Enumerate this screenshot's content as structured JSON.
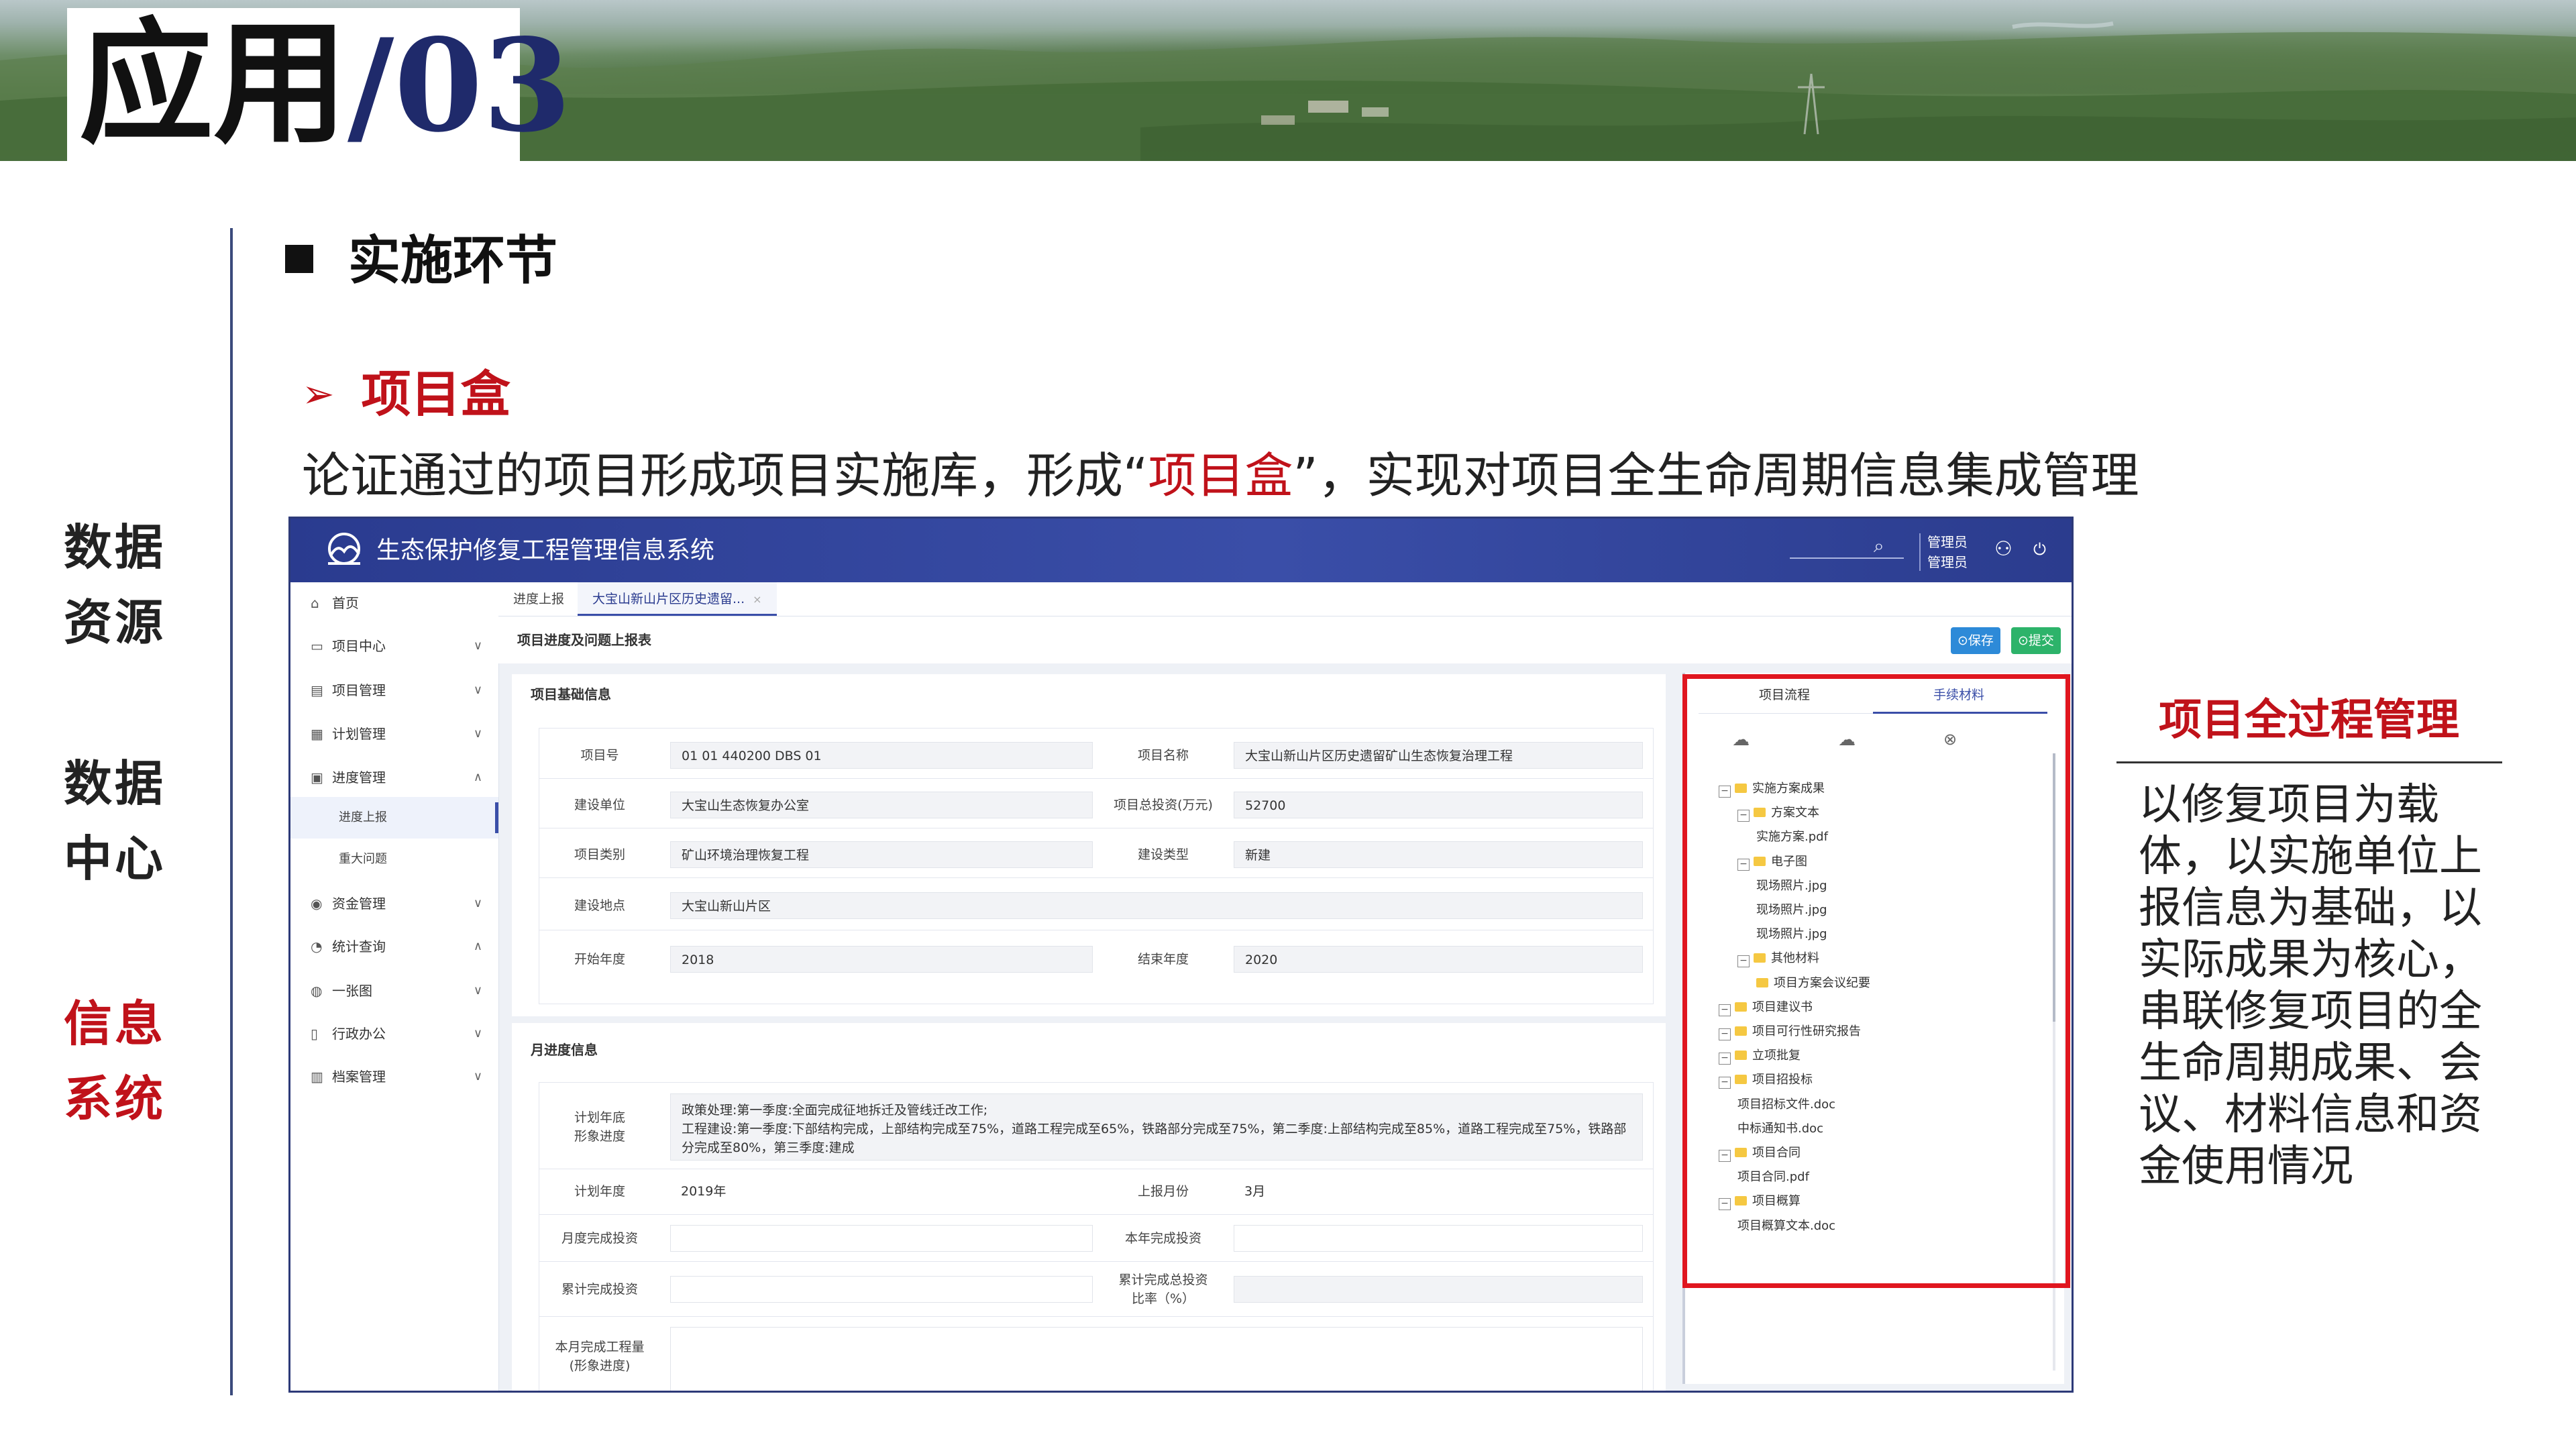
{
  "banner": {
    "title_cn": "应用",
    "title_num": "/03"
  },
  "side_labels": [
    {
      "line1": "数据",
      "line2": "资源"
    },
    {
      "line1": "数据",
      "line2": "中心"
    },
    {
      "line1": "信息",
      "line2": "系统"
    }
  ],
  "section": {
    "title": "实施环节"
  },
  "subsection": {
    "title": "项目盒"
  },
  "description": {
    "before": "论证通过的项目形成项目实施库，形成“",
    "highlight": "项目盒",
    "after": "”，实现对项目全生命周期信息集成管理"
  },
  "app": {
    "title": "生态保护修复工程管理信息系统",
    "user_line1": "管理员",
    "user_line2": "管理员",
    "sidebar": [
      {
        "icon": "home-icon",
        "label": "首页",
        "chevron": ""
      },
      {
        "icon": "calendar-icon",
        "label": "项目中心",
        "chevron": "∨"
      },
      {
        "icon": "folder-icon",
        "label": "项目管理",
        "chevron": "∨"
      },
      {
        "icon": "plan-icon",
        "label": "计划管理",
        "chevron": "∨"
      },
      {
        "icon": "progress-icon",
        "label": "进度管理",
        "chevron": "∧"
      },
      {
        "icon": "",
        "label": "进度上报",
        "chevron": ""
      },
      {
        "icon": "",
        "label": "重大问题",
        "chevron": ""
      },
      {
        "icon": "coin-icon",
        "label": "资金管理",
        "chevron": "∨"
      },
      {
        "icon": "chart-icon",
        "label": "统计查询",
        "chevron": "∧"
      },
      {
        "icon": "map-icon",
        "label": "一张图",
        "chevron": "∨"
      },
      {
        "icon": "office-icon",
        "label": "行政办公",
        "chevron": "∨"
      },
      {
        "icon": "archive-icon",
        "label": "档案管理",
        "chevron": "∨"
      }
    ],
    "tabs": [
      {
        "label": "进度上报"
      },
      {
        "label": "大宝山新山片区历史遗留..."
      }
    ],
    "page_title": "项目进度及问题上报表",
    "buttons": {
      "save": "⊙保存",
      "submit": "⊙提交"
    },
    "basic_info": {
      "title": "项目基础信息",
      "rows": [
        {
          "l1": "项目号",
          "v1": "01 01 440200 DBS 01",
          "l2": "项目名称",
          "v2": "大宝山新山片区历史遗留矿山生态恢复治理工程"
        },
        {
          "l1": "建设单位",
          "v1": "大宝山生态恢复办公室",
          "l2": "项目总投资(万元)",
          "v2": "52700"
        },
        {
          "l1": "项目类别",
          "v1": "矿山环境治理恢复工程",
          "l2": "建设类型",
          "v2": "新建"
        },
        {
          "l1": "建设地点",
          "v1": "大宝山新山片区"
        },
        {
          "l1": "开始年度",
          "v1": "2018",
          "l2": "结束年度",
          "v2": "2020"
        }
      ]
    },
    "month_info": {
      "title": "月进度信息",
      "plan_label_1": "计划年底",
      "plan_label_2": "形象进度",
      "plan_text_1": "政策处理:第一季度:全面完成征地拆迁及管线迁改工作;",
      "plan_text_2": "工程建设:第一季度:下部结构完成，上部结构完成至75%，道路工程完成至65%，铁路部分完成至75%，第二季度:上部结构完成至85%，道路工程完成至75%，铁路部",
      "plan_text_3": "分完成至80%，第三季度:建成",
      "plan_year_label": "计划年度",
      "plan_year": "2019年",
      "report_month_label": "上报月份",
      "report_month": "3月",
      "monthly_invest_label": "月度完成投资",
      "annual_invest_label": "本年完成投资",
      "cumulative_invest_label": "累计完成投资",
      "ratio_label_1": "累计完成总投资",
      "ratio_label_2": "比率（%）",
      "month_qty_label_1": "本月完成工程量",
      "month_qty_label_2": "(形象进度)"
    },
    "tree_panel": {
      "tab1": "项目流程",
      "tab2": "手续材料",
      "items": [
        {
          "level": 0,
          "toggle": "−",
          "label": "实施方案成果"
        },
        {
          "level": 1,
          "toggle": "−",
          "label": "方案文本"
        },
        {
          "level": 2,
          "toggle": "",
          "label": "实施方案.pdf",
          "file": true
        },
        {
          "level": 1,
          "toggle": "−",
          "label": "电子图"
        },
        {
          "level": 2,
          "toggle": "",
          "label": "现场照片.jpg",
          "file": true
        },
        {
          "level": 2,
          "toggle": "",
          "label": "现场照片.jpg",
          "file": true
        },
        {
          "level": 2,
          "toggle": "",
          "label": "现场照片.jpg",
          "file": true
        },
        {
          "level": 1,
          "toggle": "−",
          "label": "其他材料"
        },
        {
          "level": 2,
          "toggle": "",
          "label": "项目方案会议纪要"
        },
        {
          "level": 0,
          "toggle": "−",
          "label": "项目建议书"
        },
        {
          "level": 0,
          "toggle": "−",
          "label": "项目可行性研究报告"
        },
        {
          "level": 0,
          "toggle": "−",
          "label": "立项批复"
        },
        {
          "level": 0,
          "toggle": "−",
          "label": "项目招投标"
        },
        {
          "level": 1,
          "toggle": "",
          "label": "项目招标文件.doc",
          "file": true
        },
        {
          "level": 1,
          "toggle": "",
          "label": "中标通知书.doc",
          "file": true
        },
        {
          "level": 0,
          "toggle": "−",
          "label": "项目合同"
        },
        {
          "level": 1,
          "toggle": "",
          "label": "项目合同.pdf",
          "file": true
        },
        {
          "level": 0,
          "toggle": "−",
          "label": "项目概算"
        },
        {
          "level": 1,
          "toggle": "",
          "label": "项目概算文本.doc",
          "file": true
        }
      ]
    }
  },
  "right_panel": {
    "title": "项目全过程管理",
    "body": "以修复项目为载体，以实施单位上报信息为基础，以实际成果为核心，串联修复项目的全生命周期成果、会议、材料信息和资金使用情况"
  },
  "colors": {
    "accent_red": "#c0121a",
    "header_blue": "#2a3b8f",
    "box_red": "#e0161f"
  }
}
